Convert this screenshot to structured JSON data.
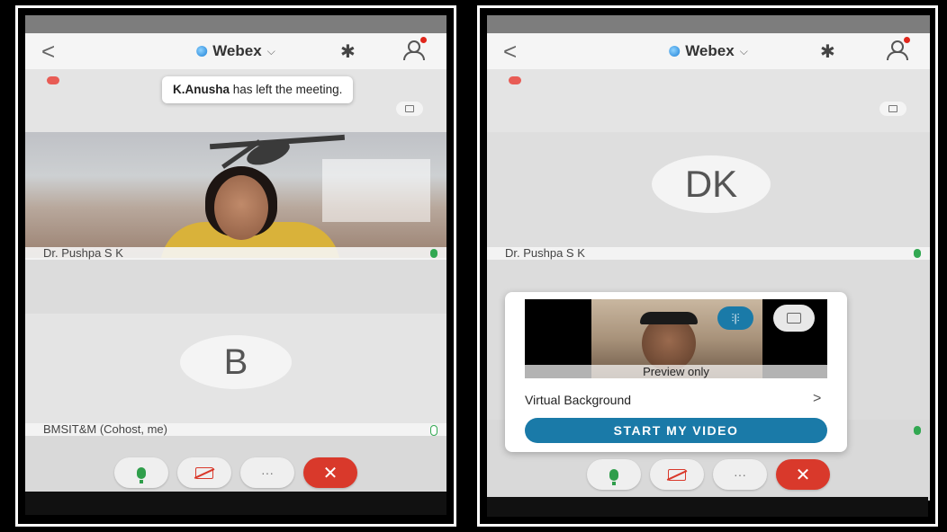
{
  "left_screen": {
    "app_name": "Webex",
    "back_glyph": "<",
    "toast": {
      "name": "K.Anusha",
      "message": "has left the meeting."
    },
    "participants": [
      {
        "name": "Dr. Pushpa S K",
        "has_video": true
      },
      {
        "name": "BMSIT&M (Cohost, me)",
        "initial": "B",
        "has_video": false
      }
    ],
    "controls": {
      "more_label": "···",
      "end_label": "✕"
    }
  },
  "right_screen": {
    "app_name": "Webex",
    "back_glyph": "<",
    "participants": [
      {
        "name": "Dr. Pushpa S K",
        "initials": "DK",
        "has_video": false
      }
    ],
    "preview_card": {
      "preview_label": "Preview only",
      "virtual_background_label": "Virtual Background",
      "start_video_label": "START MY VIDEO"
    },
    "controls": {
      "more_label": "···",
      "end_label": "✕"
    }
  },
  "colors": {
    "accent": "#1a7aa8",
    "end_call": "#d9392b",
    "mic_on": "#32a852"
  },
  "icons": [
    "back-icon",
    "webex-logo-icon",
    "bluetooth-icon",
    "participants-icon",
    "mic-icon",
    "video-off-icon",
    "more-icon",
    "end-call-icon",
    "layout-icon",
    "recording-icon",
    "audio-wave-icon",
    "camera-switch-icon"
  ]
}
